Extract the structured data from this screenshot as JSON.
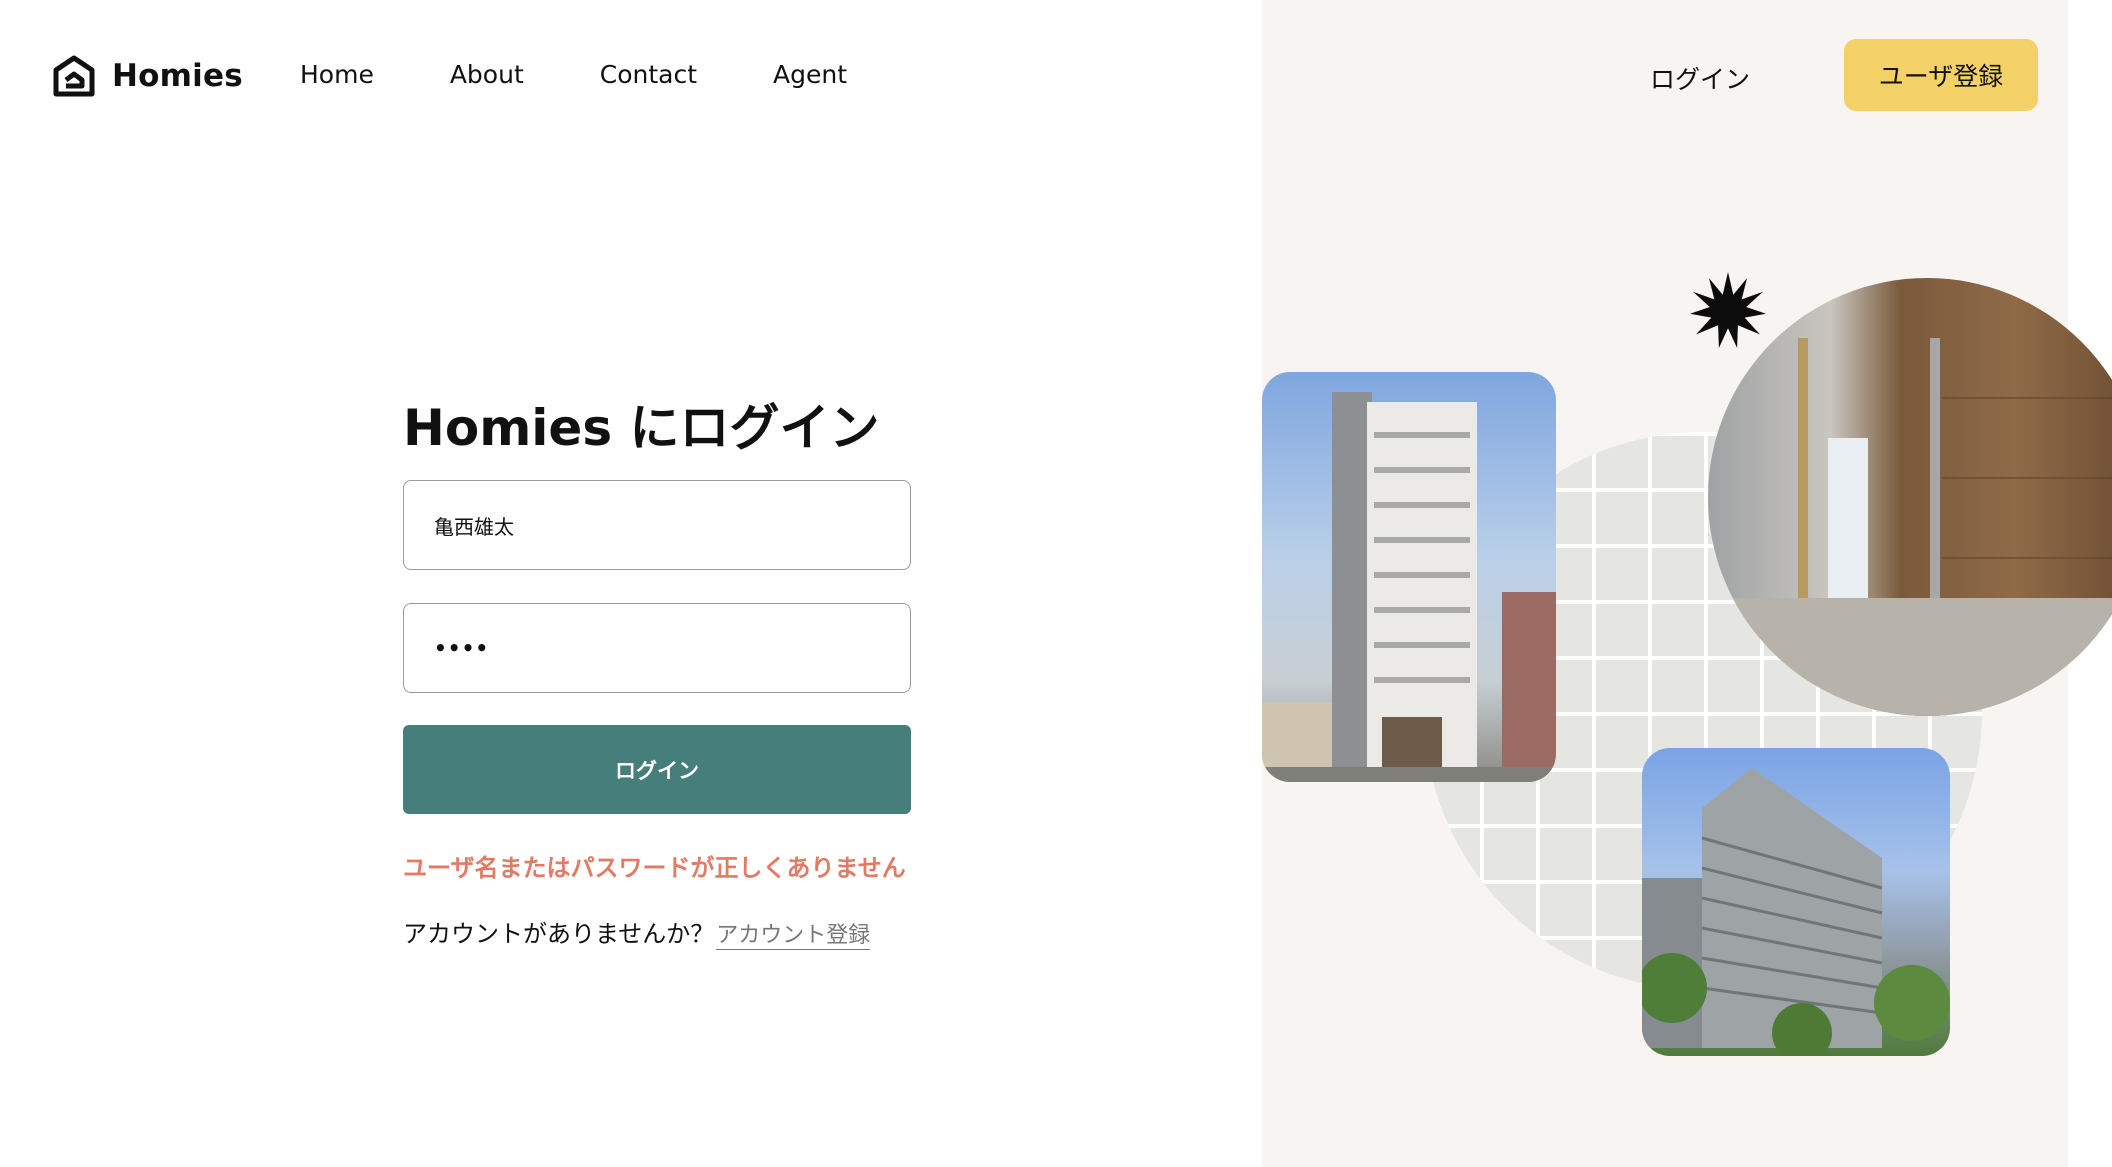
{
  "brand": {
    "name": "Homies",
    "icon": "homies-logo-icon"
  },
  "nav": {
    "items": [
      "Home",
      "About",
      "Contact",
      "Agent"
    ]
  },
  "header": {
    "login_label": "ログイン",
    "signup_label": "ユーザ登録"
  },
  "form": {
    "title": "Homies にログイン",
    "username_value": "亀西雄太",
    "password_value": "••••",
    "submit_label": "ログイン",
    "error_message": "ユーザ名またはパスワードが正しくありません",
    "no_account_text": "アカウントがありませんか？",
    "register_link": "アカウント登録"
  },
  "colors": {
    "accent_teal": "#467e7b",
    "signup_yellow": "#f3d166",
    "error_red": "#e27a64",
    "panel_beige": "#f8f4f2"
  }
}
